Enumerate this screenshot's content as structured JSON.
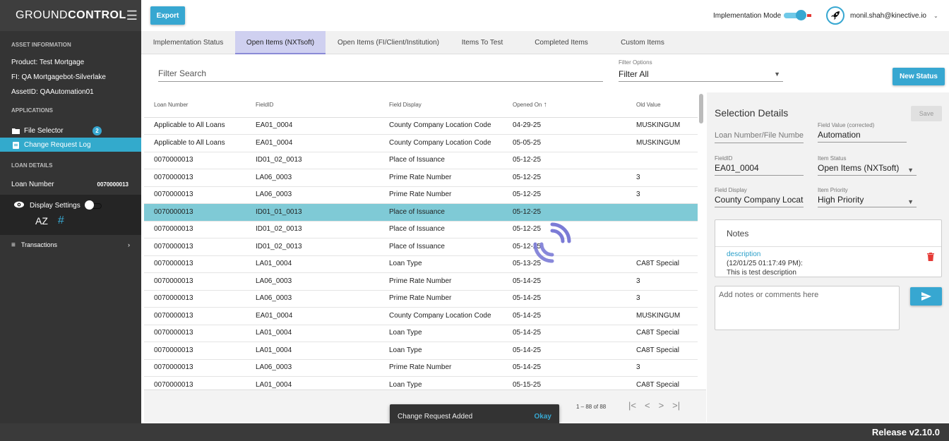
{
  "app": {
    "logo_light": "GROUND",
    "logo_bold": "CONTROL",
    "release": "Release v2.10.0"
  },
  "sidebar": {
    "asset_header": "ASSET INFORMATION",
    "product": "Product:  Test Mortgage",
    "fi": "FI:  QA Mortgagebot-Silverlake",
    "asset_id": "AssetID:  QAAutomation01",
    "applications_header": "APPLICATIONS",
    "file_selector": "File Selector",
    "file_selector_badge": "2",
    "change_request_log": "Change Request Log",
    "loan_details_header": "LOAN DETAILS",
    "loan_number_label": "Loan Number",
    "loan_number_value": "0070000013",
    "display_settings": "Display Settings",
    "sort_glyph": "AZ",
    "hash_glyph": "#",
    "transactions": "Transactions"
  },
  "topbar": {
    "export_label": "Export",
    "implementation_mode": "Implementation Mode",
    "user_email": "monil.shah@kinective.io"
  },
  "tabs": [
    "Implementation Status",
    "Open Items (NXTsoft)",
    "Open Items (FI/Client/Institution)",
    "Items To Test",
    "Completed Items",
    "Custom Items"
  ],
  "filters": {
    "search_placeholder": "Filter Search",
    "options_label": "Filter Options",
    "options_value": "Filter All",
    "new_status_label": "New Status"
  },
  "table": {
    "columns": [
      "Loan Number",
      "FieldID",
      "Field Display",
      "Opened On",
      "Old Value"
    ],
    "rows": [
      [
        "Applicable to All Loans",
        "EA01_0004",
        "County Company Location Code",
        "04-29-25",
        "MUSKINGUM"
      ],
      [
        "Applicable to All Loans",
        "EA01_0004",
        "County Company Location Code",
        "05-05-25",
        "MUSKINGUM"
      ],
      [
        "0070000013",
        "ID01_02_0013",
        "Place of Issuance",
        "05-12-25",
        ""
      ],
      [
        "0070000013",
        "LA06_0003",
        "Prime Rate Number",
        "05-12-25",
        "3"
      ],
      [
        "0070000013",
        "LA06_0003",
        "Prime Rate Number",
        "05-12-25",
        "3"
      ],
      [
        "0070000013",
        "ID01_01_0013",
        "Place of Issuance",
        "05-12-25",
        ""
      ],
      [
        "0070000013",
        "ID01_02_0013",
        "Place of Issuance",
        "05-12-25",
        ""
      ],
      [
        "0070000013",
        "ID01_02_0013",
        "Place of Issuance",
        "05-12-25",
        ""
      ],
      [
        "0070000013",
        "LA01_0004",
        "Loan Type",
        "05-13-25",
        "CA8T Special"
      ],
      [
        "0070000013",
        "LA06_0003",
        "Prime Rate Number",
        "05-14-25",
        "3"
      ],
      [
        "0070000013",
        "LA06_0003",
        "Prime Rate Number",
        "05-14-25",
        "3"
      ],
      [
        "0070000013",
        "EA01_0004",
        "County Company Location Code",
        "05-14-25",
        "MUSKINGUM"
      ],
      [
        "0070000013",
        "LA01_0004",
        "Loan Type",
        "05-14-25",
        "CA8T Special"
      ],
      [
        "0070000013",
        "LA01_0004",
        "Loan Type",
        "05-14-25",
        "CA8T Special"
      ],
      [
        "0070000013",
        "LA06_0003",
        "Prime Rate Number",
        "05-14-25",
        "3"
      ],
      [
        "0070000013",
        "LA01_0004",
        "Loan Type",
        "05-15-25",
        "CA8T Special"
      ]
    ],
    "selected_row": 5,
    "pager_range": "1 – 88 of 88"
  },
  "details": {
    "title": "Selection Details",
    "save_label": "Save",
    "loan_number_placeholder": "Loan Number/File Number",
    "field_value_label": "Field Value (corrected)",
    "field_value": "Automation",
    "fieldid_label": "FieldID",
    "fieldid_value": "EA01_0004",
    "item_status_label": "Item Status",
    "item_status_value": "Open Items (NXTsoft)",
    "field_display_label": "Field Display",
    "field_display_value": "County Company Location Code",
    "item_priority_label": "Item Priority",
    "item_priority_value": "High Priority",
    "notes_title": "Notes",
    "note_desc": "description",
    "note_time": "(12/01/25 01:17:49 PM):",
    "note_text": "This is test description",
    "add_notes_placeholder": "Add notes or comments here"
  },
  "toast": {
    "message": "Change Request Added",
    "action": "Okay"
  },
  "colors": {
    "accent": "#37a7d1",
    "selected_row": "#7fcad6",
    "active_tab": "#cfd0f0",
    "sidebar": "#343434"
  }
}
